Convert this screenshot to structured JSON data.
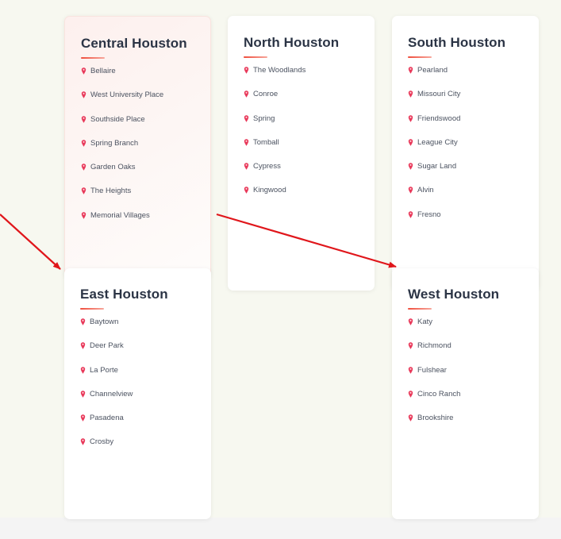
{
  "regions": {
    "central": {
      "title": "Central Houston",
      "items": [
        "Bellaire",
        "West University Place",
        "Southside Place",
        "Spring Branch",
        "Garden Oaks",
        "The Heights",
        "Memorial Villages"
      ]
    },
    "north": {
      "title": "North Houston",
      "items": [
        "The Woodlands",
        "Conroe",
        "Spring",
        "Tomball",
        "Cypress",
        "Kingwood"
      ]
    },
    "south": {
      "title": "South Houston",
      "items": [
        "Pearland",
        "Missouri City",
        "Friendswood",
        "League City",
        "Sugar Land",
        "Alvin",
        "Fresno"
      ]
    },
    "east": {
      "title": "East Houston",
      "items": [
        "Baytown",
        "Deer Park",
        "La Porte",
        "Channelview",
        "Pasadena",
        "Crosby"
      ]
    },
    "west": {
      "title": "West Houston",
      "items": [
        "Katy",
        "Richmond",
        "Fulshear",
        "Cinco Ranch",
        "Brookshire"
      ]
    }
  },
  "icon": "map-pin-icon",
  "colors": {
    "accent": "#ef4d3c",
    "pin": "#e8395a",
    "arrow": "#e0161b",
    "title": "#2b3445",
    "text": "#4b5260"
  }
}
